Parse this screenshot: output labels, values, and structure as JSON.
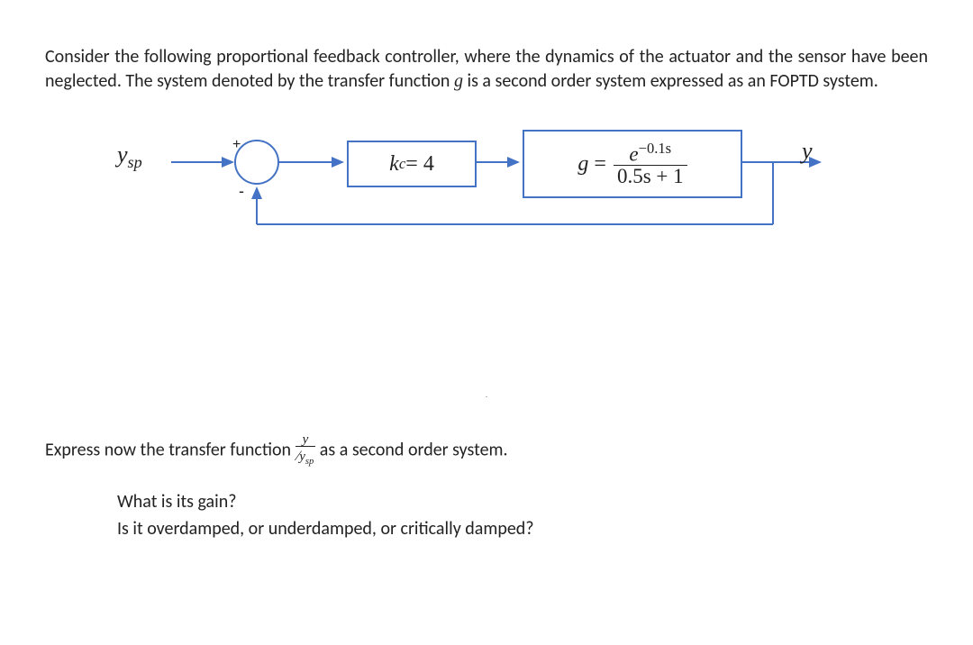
{
  "problem": {
    "intro_part1": "Consider the following proportional feedback controller, where the dynamics of the actuator and the sensor have been neglected. The system denoted by the transfer function ",
    "g_sym": "g",
    "intro_part2": " is a second order system expressed as an FOPTD system."
  },
  "diagram": {
    "input_label": "y",
    "input_sub": "sp",
    "output_label": "y",
    "sum_plus": "+",
    "sum_minus": "-",
    "kc": {
      "k": "k",
      "sub": "c",
      "eq": " = 4"
    },
    "g": {
      "sym": "g",
      "eq": " = ",
      "num_base": "e",
      "num_exp": "−0.1s",
      "den": "0.5s + 1"
    }
  },
  "questions": {
    "express_pre": "Express now the transfer function ",
    "tf_num": "y",
    "tf_den_y": "y",
    "tf_den_sub": "sp",
    "express_post": " as a second order system.",
    "q1": "What is its gain?",
    "q2": "Is it overdamped, or underdamped, or critically damped?"
  }
}
